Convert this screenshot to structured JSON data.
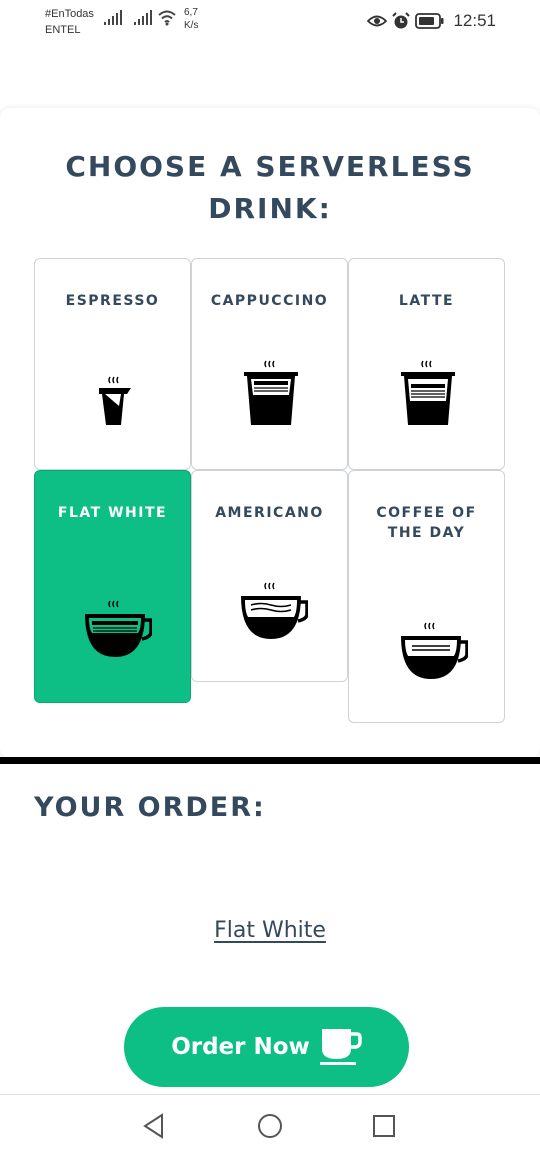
{
  "status_bar": {
    "carrier_top": "#EnTodas",
    "carrier_bottom": "ENTEL",
    "speed_value": "6,7",
    "speed_unit": "K/s",
    "time": "12:51",
    "icons": [
      "signal-icon",
      "signal-icon",
      "wifi-icon",
      "eye-icon",
      "alarm-icon",
      "battery-icon"
    ]
  },
  "menu": {
    "title": "CHOOSE A SERVERLESS DRINK:",
    "drinks": [
      {
        "label": "ESPRESSO",
        "icon": "espresso-cup-icon",
        "selected": false
      },
      {
        "label": "CAPPUCCINO",
        "icon": "cappuccino-glass-icon",
        "selected": false
      },
      {
        "label": "LATTE",
        "icon": "latte-glass-icon",
        "selected": false
      },
      {
        "label": "FLAT WHITE",
        "icon": "flat-white-cup-icon",
        "selected": true
      },
      {
        "label": "AMERICANO",
        "icon": "americano-cup-icon",
        "selected": false
      },
      {
        "label": "COFFEE OF THE DAY",
        "icon": "coffee-cup-icon",
        "selected": false
      }
    ]
  },
  "order": {
    "heading": "YOUR ORDER:",
    "item": "Flat White",
    "button_label": "Order Now",
    "button_icon": "coffee-mug-icon"
  },
  "colors": {
    "accent": "#0dbf85",
    "text": "#34495e",
    "border": "#cfd3d6"
  },
  "nav": {
    "icons": [
      "back-icon",
      "home-icon",
      "recents-icon"
    ]
  }
}
